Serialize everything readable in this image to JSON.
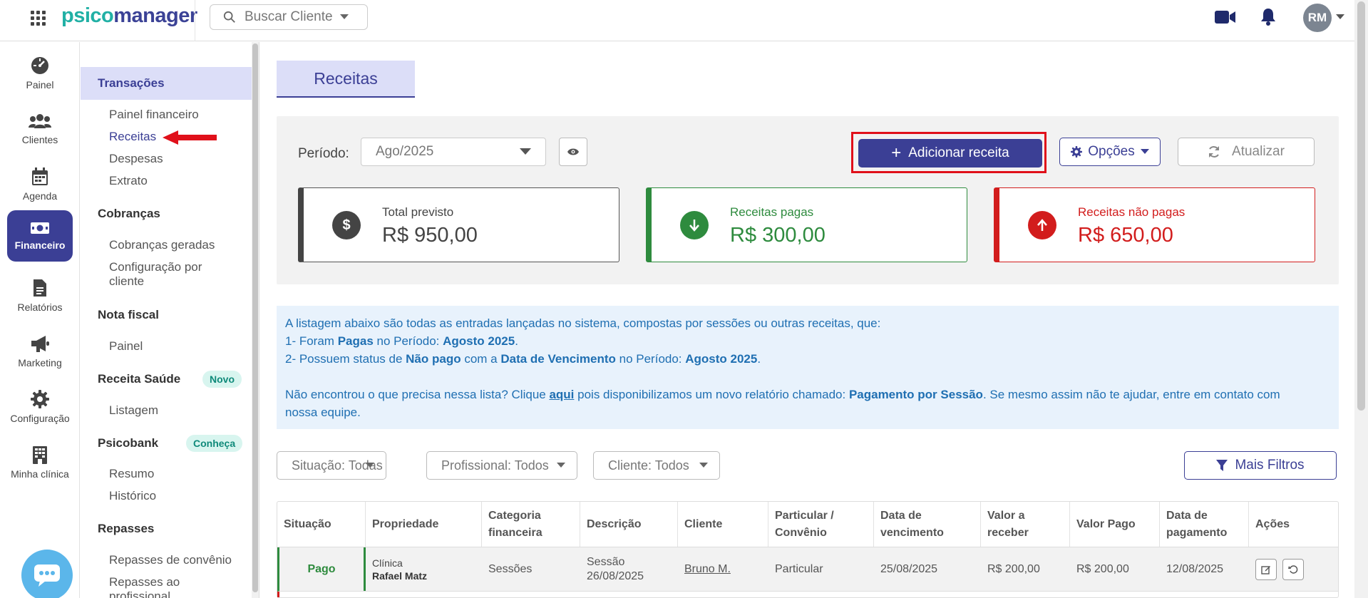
{
  "app": {
    "logo_part1": "psico",
    "logo_part2": "manager",
    "search_placeholder": "Buscar Cliente",
    "avatar_initials": "RM"
  },
  "rail": [
    {
      "label": "Painel",
      "icon": "dashboard-gauge-icon"
    },
    {
      "label": "Clientes",
      "icon": "users-icon"
    },
    {
      "label": "Agenda",
      "icon": "calendar-icon"
    },
    {
      "label": "Financeiro",
      "icon": "money-bill-icon",
      "active": true
    },
    {
      "label": "Relatórios",
      "icon": "file-report-icon"
    },
    {
      "label": "Marketing",
      "icon": "megaphone-icon"
    },
    {
      "label": "Configuração",
      "icon": "gear-icon"
    },
    {
      "label": "Minha clínica",
      "icon": "building-icon"
    }
  ],
  "sidebar": {
    "transacoes": "Transações",
    "painel_financeiro": "Painel financeiro",
    "receitas": "Receitas",
    "despesas": "Despesas",
    "extrato": "Extrato",
    "cobrancas": "Cobranças",
    "cobrancas_geradas": "Cobranças geradas",
    "config_por_cliente_1": "Configuração por",
    "config_por_cliente_2": "cliente",
    "nota_fiscal": "Nota fiscal",
    "nf_painel": "Painel",
    "receita_saude": "Receita Saúde",
    "receita_saude_badge": "Novo",
    "listagem": "Listagem",
    "psicobank": "Psicobank",
    "psicobank_badge": "Conheça",
    "resumo": "Resumo",
    "historico": "Histórico",
    "repasses": "Repasses",
    "repasses_convenio": "Repasses de convênio",
    "repasses_prof_1": "Repasses ao",
    "repasses_prof_2": "profissional"
  },
  "main": {
    "tab_title": "Receitas",
    "periodo_label": "Período:",
    "periodo_value": "Ago/2025",
    "add_button": "Adicionar receita",
    "opcoes_button": "Opções",
    "atualizar_button": "Atualizar",
    "cards": {
      "total": {
        "label": "Total previsto",
        "value": "R$ 950,00",
        "icon_glyph": "$"
      },
      "pagas": {
        "label": "Receitas pagas",
        "value": "R$ 300,00"
      },
      "nao_pagas": {
        "label": "Receitas não pagas",
        "value": "R$ 650,00"
      }
    },
    "info": {
      "line1": "A listagem abaixo são todas as entradas lançadas no sistema, compostas por sessões ou outras receitas, que:",
      "l2a": "1- Foram ",
      "l2b": "Pagas",
      "l2c": " no Período: ",
      "l2d": "Agosto 2025",
      "l2e": ".",
      "l3a": "2- Possuem status de ",
      "l3b": "Não pago",
      "l3c": " com a ",
      "l3d": "Data de Vencimento",
      "l3e": " no Período: ",
      "l3f": "Agosto 2025",
      "l3g": ".",
      "l4a": "Não encontrou o que precisa nessa lista? Clique ",
      "l4b": "aqui",
      "l4c": " pois disponibilizamos um novo relatório chamado: ",
      "l4d": "Pagamento por Sessão",
      "l4e": ". Se mesmo assim não te ajudar, entre em contato com",
      "l5": "nossa equipe."
    },
    "filters": {
      "situacao": "Situação: Todas",
      "profissional": "Profissional: Todos",
      "cliente": "Cliente: Todos",
      "mais_filtros": "Mais Filtros"
    },
    "table": {
      "headers": {
        "situacao": "Situação",
        "propriedade": "Propriedade",
        "categoria_1": "Categoria",
        "categoria_2": "financeira",
        "descricao": "Descrição",
        "cliente": "Cliente",
        "particular_1": "Particular /",
        "particular_2": "Convênio",
        "vencimento_1": "Data de",
        "vencimento_2": "vencimento",
        "valor_receber_1": "Valor a",
        "valor_receber_2": "receber",
        "valor_pago": "Valor Pago",
        "pagamento_1": "Data de",
        "pagamento_2": "pagamento",
        "acoes": "Ações"
      },
      "rows": [
        {
          "situacao": "Pago",
          "prop_line1": "Clínica",
          "prop_line2": "Rafael Matz",
          "categoria": "Sessões",
          "desc_line1": "Sessão",
          "desc_line2": "26/08/2025",
          "cliente": "Bruno M.",
          "particular": "Particular",
          "vencimento": "25/08/2025",
          "valor_receber": "R$ 200,00",
          "valor_pago": "R$ 200,00",
          "pagamento": "12/08/2025"
        }
      ]
    }
  },
  "colors": {
    "brand": "#3b3f95",
    "teal": "#21b0a5",
    "paid": "#2e8b3e",
    "unpaid": "#d21d1d",
    "info_bg": "#e8f2fc"
  }
}
